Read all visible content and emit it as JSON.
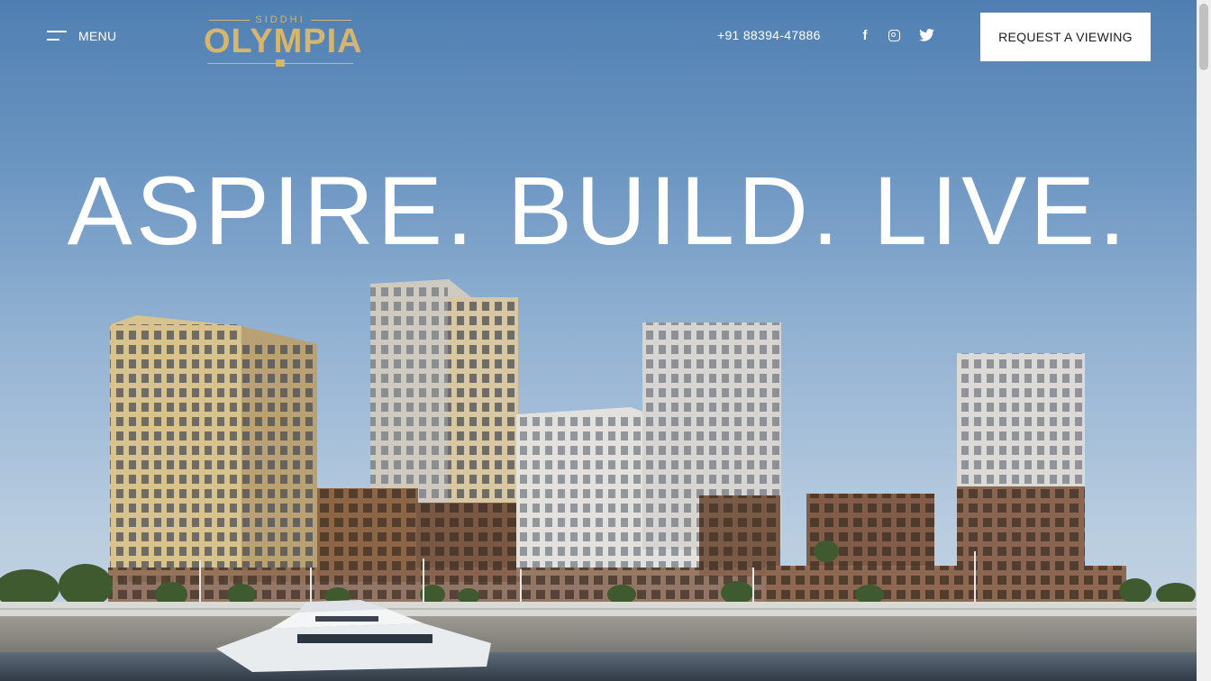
{
  "header": {
    "menu_label": "MENU",
    "logo": {
      "small_text": "SIDDHI",
      "main_text": "OLYMPIA"
    },
    "phone": "+91 88394-47886",
    "social_icons": [
      "facebook-icon",
      "instagram-icon",
      "twitter-icon"
    ],
    "cta_label": "REQUEST A VIEWING"
  },
  "hero": {
    "headline": "ASPIRE. BUILD. LIVE."
  },
  "colors": {
    "logo_gold": "#d6b56d",
    "cta_background": "#ffffff",
    "sky_top": "#4f7fb2",
    "sky_bottom": "#c9d6e2"
  }
}
